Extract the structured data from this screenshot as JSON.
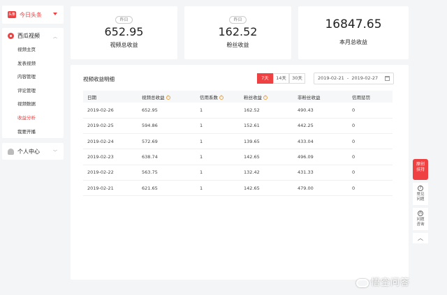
{
  "app": {
    "name": "今日头条"
  },
  "sidebar": {
    "section_title": "西瓜视频",
    "items": [
      {
        "label": "视频主页"
      },
      {
        "label": "发表视频"
      },
      {
        "label": "内容管理"
      },
      {
        "label": "评论管理"
      },
      {
        "label": "视频数据"
      },
      {
        "label": "收益分析"
      },
      {
        "label": "我要开播"
      }
    ],
    "active_item": "收益分析",
    "user_section": "个人中心"
  },
  "stats": [
    {
      "badge": "昨日",
      "value": "652.95",
      "label": "视频总收益"
    },
    {
      "badge": "昨日",
      "value": "162.52",
      "label": "粉丝收益"
    },
    {
      "badge": "",
      "value": "16847.65",
      "label": "本月总收益"
    }
  ],
  "panel": {
    "title": "视频收益明细",
    "ranges": [
      "7天",
      "14天",
      "30天"
    ],
    "active_range": "7天",
    "date_range": "2019-02-21  -  2019-02-27",
    "columns": [
      "日期",
      "视频总收益",
      "信用系数",
      "粉丝收益",
      "非粉丝收益",
      "信用惩罚"
    ],
    "rows": [
      [
        "2019-02-26",
        "652.95",
        "1",
        "162.52",
        "490.43",
        "0"
      ],
      [
        "2019-02-25",
        "594.86",
        "1",
        "152.61",
        "442.25",
        "0"
      ],
      [
        "2019-02-24",
        "572.69",
        "1",
        "139.65",
        "433.04",
        "0"
      ],
      [
        "2019-02-23",
        "638.74",
        "1",
        "142.65",
        "496.09",
        "0"
      ],
      [
        "2019-02-22",
        "563.75",
        "1",
        "132.42",
        "431.33",
        "0"
      ],
      [
        "2019-02-21",
        "621.65",
        "1",
        "142.65",
        "479.00",
        "0"
      ]
    ]
  },
  "tools": {
    "promo": "原创扶持",
    "faq": "常见问题",
    "consult": "问题咨询"
  },
  "watermark": "悟空问答",
  "colors": {
    "accent": "#f04142"
  }
}
